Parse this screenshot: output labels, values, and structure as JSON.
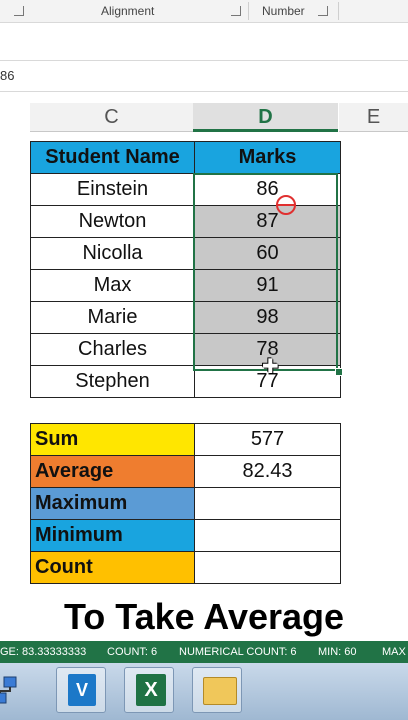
{
  "ribbon": {
    "group1": "Alignment",
    "group2": "Number"
  },
  "formula_bar": {
    "value": "86"
  },
  "columns": {
    "c": "C",
    "d": "D",
    "e": "E"
  },
  "table": {
    "headers": [
      "Student Name",
      "Marks"
    ],
    "rows": [
      [
        "Einstein",
        "86"
      ],
      [
        "Newton",
        "87"
      ],
      [
        "Nicolla",
        "60"
      ],
      [
        "Max",
        "91"
      ],
      [
        "Marie",
        "98"
      ],
      [
        "Charles",
        "78"
      ],
      [
        "Stephen",
        "77"
      ]
    ]
  },
  "stats": {
    "rows": [
      {
        "label": "Sum",
        "value": "577",
        "color": "#ffe600"
      },
      {
        "label": "Average",
        "value": "82.43",
        "color": "#ef7d2f"
      },
      {
        "label": "Maximum",
        "value": "",
        "color": "#5b9bd5"
      },
      {
        "label": "Minimum",
        "value": "",
        "color": "#19a4df"
      },
      {
        "label": "Count",
        "value": "",
        "color": "#ffc000"
      }
    ]
  },
  "caption": "To Take Average",
  "status_bar": {
    "average": "GE: 83.33333333",
    "count": "COUNT: 6",
    "numerical_count": "NUMERICAL COUNT: 6",
    "min": "MIN: 60",
    "max": "MAX"
  },
  "taskbar": {
    "apps": [
      "network-app",
      "visual-studio",
      "excel",
      "file-explorer"
    ],
    "vs_glyph": "V",
    "xl_glyph": "X"
  },
  "colors": {
    "header_blue": "#19a4df",
    "excel_green": "#217346",
    "selection_gray": "#c8c8c8"
  }
}
